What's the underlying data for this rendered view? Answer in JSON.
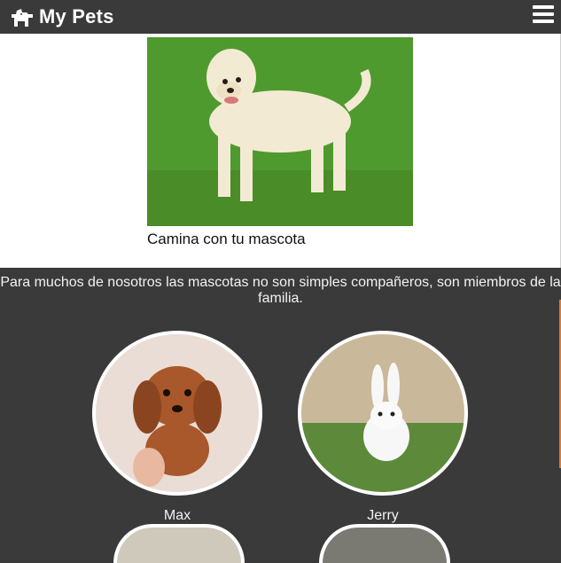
{
  "header": {
    "title": "My Pets",
    "logo_icon": "dog-icon",
    "menu_icon": "hamburger-menu-icon"
  },
  "hero": {
    "image": "labrador-dog-photo",
    "caption": "Camina con tu mascota"
  },
  "intro": {
    "text": "Para muchos de nosotros las mascotas no son simples compañeros, son miembros de la familia."
  },
  "pets": [
    {
      "name": "Max",
      "image": "puppy-dachshund-photo"
    },
    {
      "name": "Jerry",
      "image": "white-rabbit-photo"
    }
  ],
  "colors": {
    "header_bg": "#3a3a3a",
    "section_bg": "#3a3a3a",
    "content_bg": "#ffffff",
    "accent": "#e07a2e"
  }
}
